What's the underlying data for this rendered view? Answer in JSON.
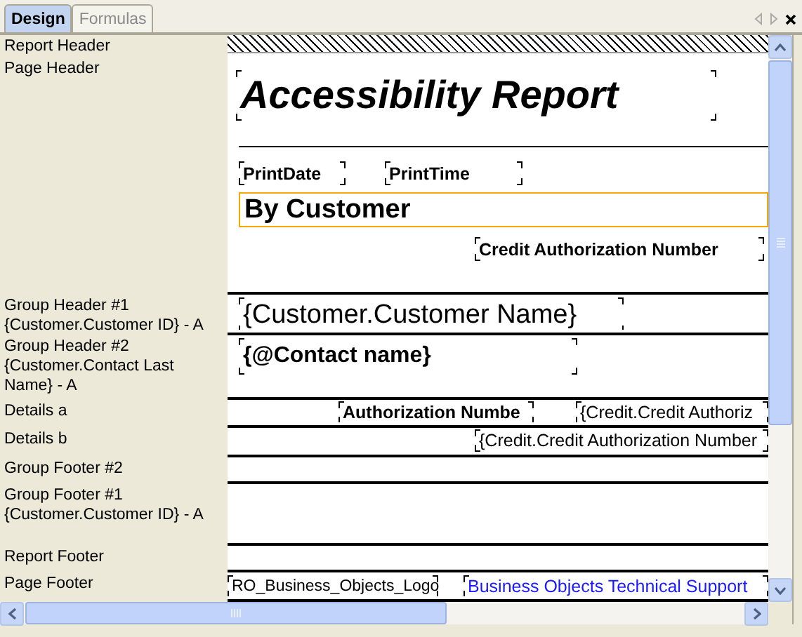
{
  "tabs": [
    {
      "label": "Design",
      "selected": true
    },
    {
      "label": "Formulas",
      "selected": false
    }
  ],
  "sections": [
    {
      "label": "Report Header",
      "kind": "hatched"
    },
    {
      "label": "Page Header",
      "kind": "band",
      "fields": [
        {
          "text": "Accessibility Report",
          "kind": "title",
          "selected": false
        },
        {
          "text": "PrintDate",
          "kind": "bold",
          "selected": false
        },
        {
          "text": "PrintTime",
          "kind": "bold",
          "selected": false
        },
        {
          "text": "By Customer",
          "kind": "heading",
          "selected": true
        },
        {
          "text": "Credit Authorization Number",
          "kind": "bold",
          "selected": false
        }
      ]
    },
    {
      "label": "Group Header #1\n{Customer.Customer ID} - A",
      "kind": "band",
      "fields": [
        {
          "text": "{Customer.Customer Name}",
          "kind": "large",
          "selected": false
        }
      ]
    },
    {
      "label": "Group Header #2\n{Customer.Contact Last\nName} - A",
      "kind": "band",
      "fields": [
        {
          "text": "{@Contact name}",
          "kind": "large-bold",
          "selected": false
        }
      ]
    },
    {
      "label": "Details a",
      "kind": "band",
      "fields": [
        {
          "text": "Authorization Numbe",
          "kind": "bold",
          "selected": false
        },
        {
          "text": "{Credit.Credit Authoriz",
          "kind": "plain",
          "selected": false
        }
      ]
    },
    {
      "label": "Details b",
      "kind": "band",
      "fields": [
        {
          "text": "{Credit.Credit Authorization Number",
          "kind": "plain",
          "selected": false
        }
      ]
    },
    {
      "label": "Group Footer #2",
      "kind": "band"
    },
    {
      "label": "Group Footer #1\n{Customer.Customer ID} - A",
      "kind": "band"
    },
    {
      "label": "Report Footer",
      "kind": "band"
    },
    {
      "label": "Page Footer",
      "kind": "band",
      "fields": [
        {
          "text": "RO_Business_Objects_Logo",
          "kind": "small",
          "selected": false
        },
        {
          "text": "Business Objects Technical Support",
          "kind": "link",
          "selected": false
        }
      ]
    }
  ]
}
